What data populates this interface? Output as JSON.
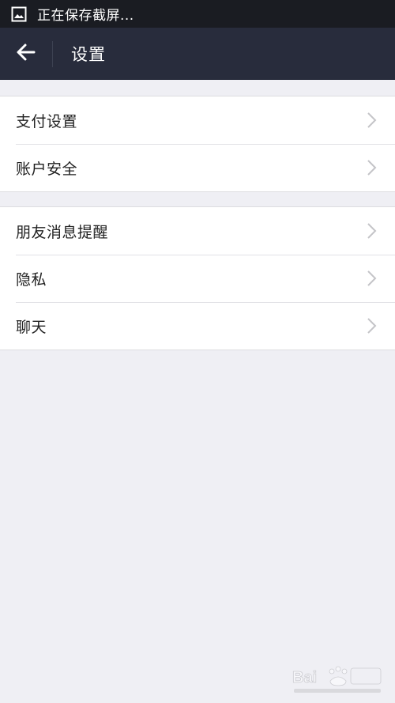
{
  "status_bar": {
    "notification_icon": "image-icon",
    "text": "正在保存截屏..."
  },
  "app_bar": {
    "back_icon": "arrow-left-icon",
    "title": "设置"
  },
  "groups": [
    {
      "items": [
        {
          "label": "支付设置",
          "icon": "chevron-right-icon"
        },
        {
          "label": "账户安全",
          "icon": "chevron-right-icon"
        }
      ]
    },
    {
      "items": [
        {
          "label": "朋友消息提醒",
          "icon": "chevron-right-icon"
        },
        {
          "label": "隐私",
          "icon": "chevron-right-icon"
        },
        {
          "label": "聊天",
          "icon": "chevron-right-icon"
        }
      ]
    }
  ],
  "colors": {
    "status_bar_bg": "#1a1c22",
    "app_bar_bg": "#282c3c",
    "page_bg": "#efeff4",
    "row_bg": "#ffffff",
    "chevron": "#c4c4c8"
  },
  "watermark": "baidu-jingyan-logo"
}
